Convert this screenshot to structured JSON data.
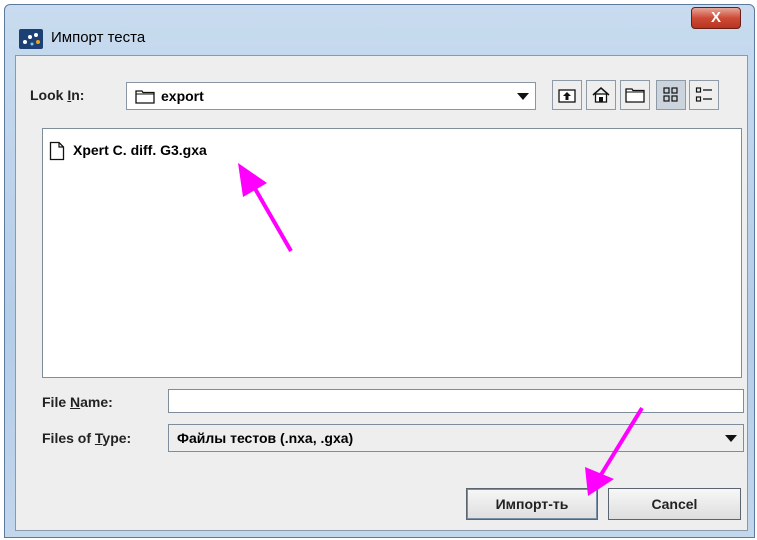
{
  "window": {
    "title": "Импорт теста",
    "close_label": "X"
  },
  "look_in": {
    "label_prefix": "Look ",
    "label_mnemonic": "I",
    "label_suffix": "n:",
    "value": "export"
  },
  "toolbar": {
    "icons": [
      "up-one-level-icon",
      "home-icon",
      "new-folder-icon",
      "list-view-icon",
      "details-view-icon"
    ]
  },
  "files": [
    {
      "name": "Xpert C. diff. G3.gxa",
      "icon": "document-icon"
    }
  ],
  "file_name": {
    "label_prefix": "File ",
    "label_mnemonic": "N",
    "label_suffix": "ame:",
    "value": ""
  },
  "file_type": {
    "label_prefix": "Files of ",
    "label_mnemonic": "T",
    "label_suffix": "ype:",
    "value": "Файлы тестов (.nxa, .gxa)"
  },
  "buttons": {
    "import_label": "Импорт-ть",
    "cancel_label": "Cancel"
  },
  "colors": {
    "annotation_arrow": "#ff00ff",
    "title_bar": "#b4cde8",
    "close_button": "#cd4b36"
  }
}
